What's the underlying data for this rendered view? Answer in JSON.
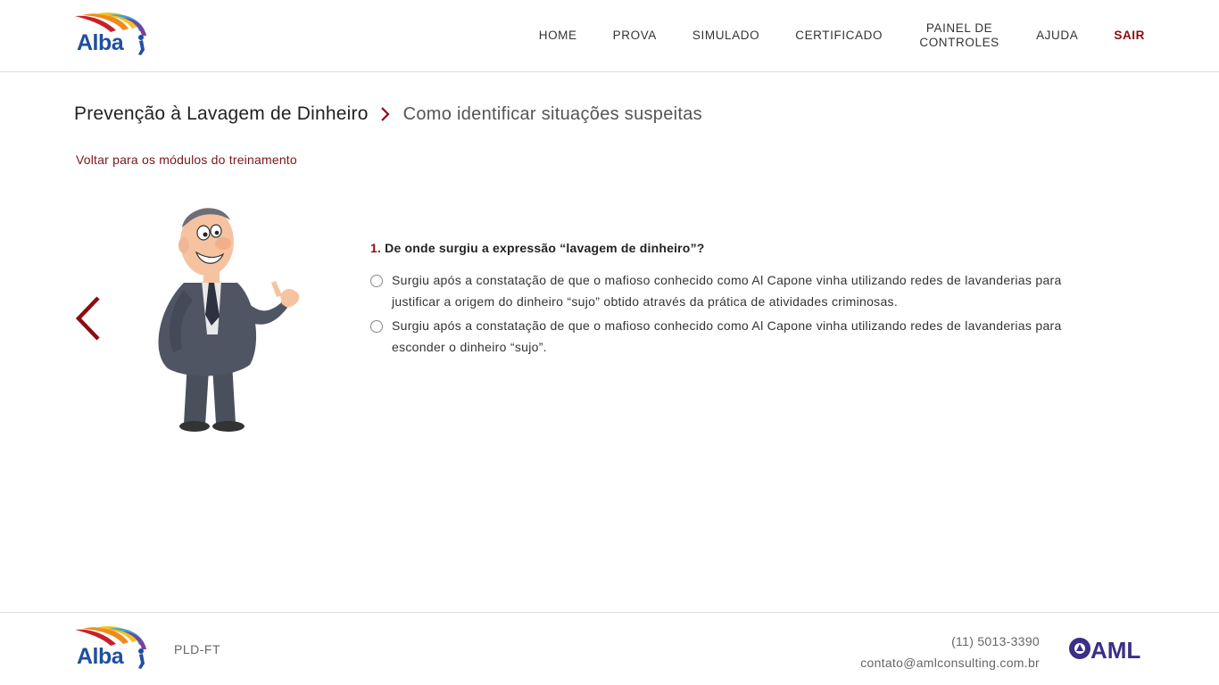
{
  "header": {
    "logo_text": "Alba",
    "nav": [
      {
        "label": "HOME"
      },
      {
        "label": "PROVA"
      },
      {
        "label": "SIMULADO"
      },
      {
        "label": "CERTIFICADO"
      },
      {
        "label": "PAINEL DE",
        "label2": "CONTROLES"
      },
      {
        "label": "AJUDA"
      },
      {
        "label": "SAIR"
      }
    ]
  },
  "breadcrumb": {
    "main": "Prevenção à Lavagem de Dinheiro",
    "sub": "Como identificar situações suspeitas"
  },
  "back_link": "Voltar para os módulos do treinamento",
  "question": {
    "number": "1.",
    "text": "De onde surgiu a expressão “lavagem de dinheiro”?",
    "options": [
      "Surgiu após a constatação de que o mafioso conhecido como Al Capone vinha utilizando redes de lavanderias para justificar a origem do dinheiro “sujo” obtido através da prática de atividades criminosas.",
      "Surgiu após a constatação de que o mafioso conhecido como Al Capone vinha utilizando redes de lavanderias para esconder o dinheiro “sujo”."
    ]
  },
  "footer": {
    "logo_text": "Alba",
    "label": "PLD-FT",
    "phone": "(11) 5013-3390",
    "email": "contato@amlconsulting.com.br",
    "partner_logo_text": "AML"
  },
  "colors": {
    "accent": "#8b0d12",
    "brand_blue": "#1f4fa0",
    "aml_purple": "#3b2f86"
  },
  "icons": {
    "breadcrumb_separator": "chevron-right-icon",
    "previous": "chevron-left-icon"
  }
}
